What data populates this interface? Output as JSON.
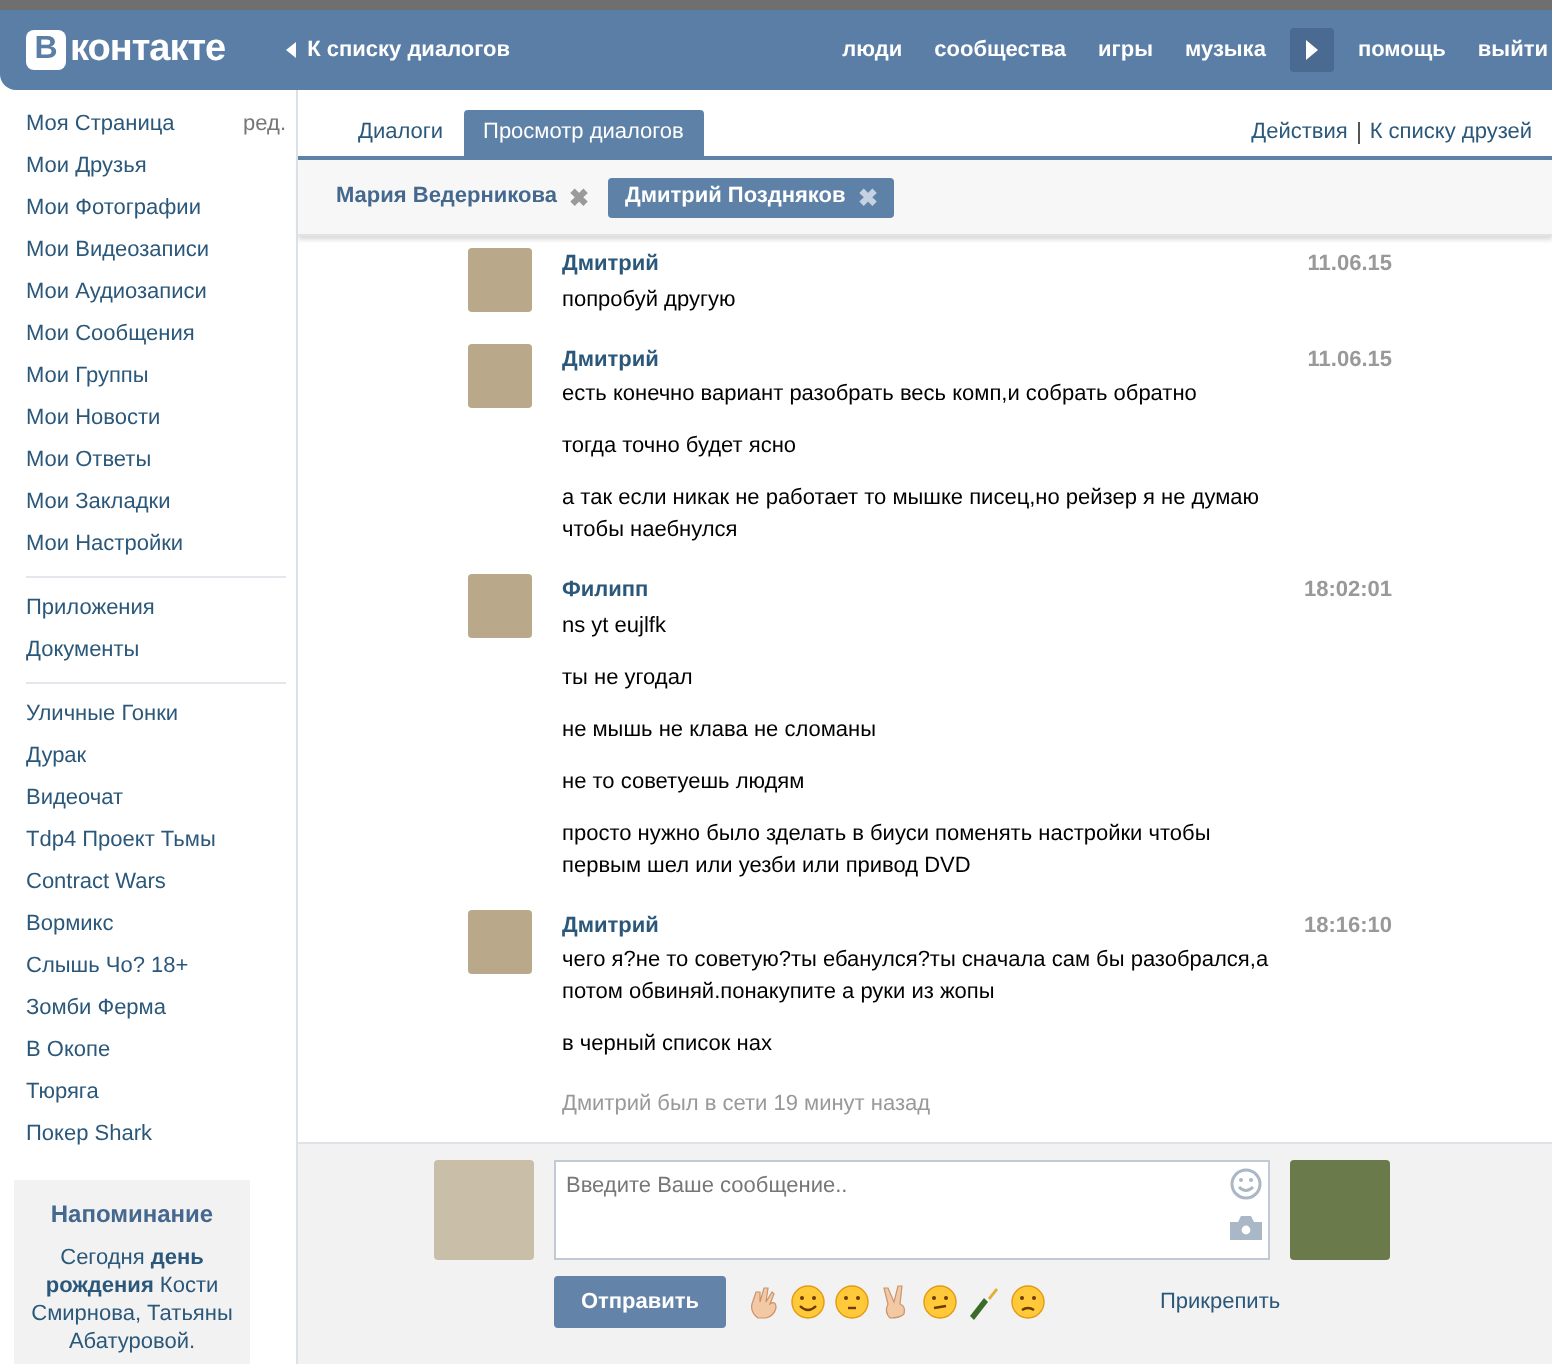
{
  "header": {
    "logo": {
      "letter": "В",
      "text": "контакте"
    },
    "back_link": "К списку диалогов",
    "nav": [
      "люди",
      "сообщества",
      "игры",
      "музыка"
    ],
    "nav_after": [
      "помощь",
      "выйти"
    ]
  },
  "sidebar": {
    "edit_link": "ред.",
    "sections": [
      [
        "Моя Страница",
        "Мои Друзья",
        "Мои Фотографии",
        "Мои Видеозаписи",
        "Мои Аудиозаписи",
        "Мои Сообщения",
        "Мои Группы",
        "Мои Новости",
        "Мои Ответы",
        "Мои Закладки",
        "Мои Настройки"
      ],
      [
        "Приложения",
        "Документы"
      ],
      [
        "Уличные Гонки",
        "Дурак",
        "Видеочат",
        "Tdp4 Проект Тьмы",
        "Contract Wars",
        "Вормикс",
        "Слышь Чо? 18+",
        "Зомби Ферма",
        "В Окопе",
        "Тюряга",
        "Покер Shark"
      ]
    ],
    "reminder": {
      "title": "Напоминание",
      "text": "Сегодня **день рождения** Кости Смирнова, Татьяны Абатуровой."
    }
  },
  "tabs": [
    {
      "label": "Диалоги",
      "selected": false
    },
    {
      "label": "Просмотр диалогов",
      "selected": true
    }
  ],
  "actions": [
    "Действия",
    "К списку друзей"
  ],
  "chips": [
    {
      "label": "Мария Ведерникова",
      "selected": false,
      "close": "✖"
    },
    {
      "label": "Дмитрий Поздняков",
      "selected": true,
      "close": "✖"
    }
  ],
  "messages": [
    {
      "author": "Дмитрий",
      "time": "11.06.15",
      "lines": [
        "попробуй другую"
      ]
    },
    {
      "author": "Дмитрий",
      "time": "11.06.15",
      "lines": [
        "есть конечно вариант разобрать весь комп,и собрать обратно",
        "тогда точно будет ясно",
        "а так если никак не работает то мышке писец,но рейзер я не думаю чтобы наебнулся"
      ]
    },
    {
      "author": "Филипп",
      "time": "18:02:01",
      "lines": [
        "ns yt eujlfk",
        "ты не угодал",
        "не мышь не клава не сломаны",
        "не то советуешь людям",
        "просто нужно было зделать в биуси поменять настройки чтобы первым шел или уезби или привод DVD"
      ]
    },
    {
      "author": "Дмитрий",
      "time": "18:16:10",
      "lines": [
        "чего я?не то советую?ты ебанулся?ты сначала сам бы разобрался,а потом обвиняй.понакупите а руки из жопы",
        "в черный список нах"
      ]
    }
  ],
  "status": "Дмитрий был в сети 19 минут назад",
  "composer": {
    "placeholder": "Введите Ваше сообщение..",
    "send": "Отправить",
    "attach": "Прикрепить"
  }
}
